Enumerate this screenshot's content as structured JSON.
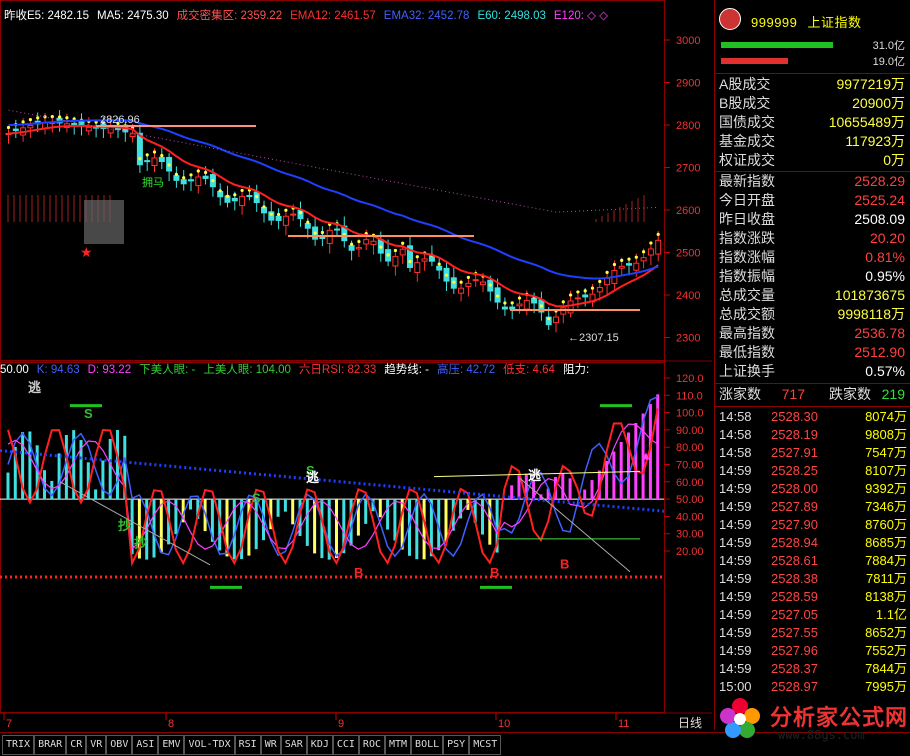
{
  "main_indicators": [
    {
      "label": "昨收E5: 2482.15",
      "color": "#ffffff"
    },
    {
      "label": "MA5: 2475.30",
      "color": "#ffffff"
    },
    {
      "label": "成交密集区: 2359.22",
      "color": "#ff5050"
    },
    {
      "label": "EMA12: 2461.57",
      "color": "#ff3030"
    },
    {
      "label": "EMA32: 2452.78",
      "color": "#4060ff"
    },
    {
      "label": "E60: 2498.03",
      "color": "#30e0e0"
    },
    {
      "label": "E120: ◇ ◇",
      "color": "#ff40ff"
    }
  ],
  "main_price_axis": [
    "3000",
    "2900",
    "2800",
    "2700",
    "2600",
    "2500",
    "2400",
    "2300"
  ],
  "main_annotations": {
    "high_label": "2826.96",
    "low_label": "←2307.15",
    "text_tag": "拥马"
  },
  "sub_indicators": [
    {
      "label": "50.00",
      "color": "#ffffff"
    },
    {
      "label": "K: 94.63",
      "color": "#4060ff"
    },
    {
      "label": "D: 93.22",
      "color": "#ff40ff"
    },
    {
      "label": "下美人眼: -",
      "color": "#30d030"
    },
    {
      "label": "上美人眼: 104.00",
      "color": "#30d030"
    },
    {
      "label": "六日RSI: 82.33",
      "color": "#ff3030"
    },
    {
      "label": "趋势线: -",
      "color": "#ffffff"
    },
    {
      "label": "高压: 42.72",
      "color": "#4060ff"
    },
    {
      "label": "低支: 4.64",
      "color": "#ff3030"
    },
    {
      "label": "阻力:",
      "color": "#ffffff"
    }
  ],
  "sub_axis": [
    "120.0",
    "110.0",
    "100.0",
    "90.00",
    "80.00",
    "70.00",
    "60.00",
    "50.00",
    "40.00",
    "30.00",
    "20.00"
  ],
  "sub_markers": [
    "S",
    "S",
    "S",
    "B",
    "B",
    "B",
    "抄",
    "抄",
    "逃",
    "逃",
    "逃"
  ],
  "date_axis": [
    "7",
    "8",
    "9",
    "10",
    "11"
  ],
  "period_label": "日线",
  "panel": {
    "code": "999999",
    "name": "上证指数",
    "flow": [
      {
        "value": "31.0亿",
        "color": "#20c020",
        "fraction": 0.8
      },
      {
        "value": "19.0亿",
        "color": "#e03030",
        "fraction": 0.48
      }
    ],
    "volumes": [
      {
        "k": "A股成交",
        "v": "9977219万"
      },
      {
        "k": "B股成交",
        "v": "20900万"
      },
      {
        "k": "国债成交",
        "v": "10655489万"
      },
      {
        "k": "基金成交",
        "v": "117923万"
      },
      {
        "k": "权证成交",
        "v": "0万"
      }
    ],
    "stats": [
      {
        "k": "最新指数",
        "v": "2528.29",
        "c": "#ff4040"
      },
      {
        "k": "今日开盘",
        "v": "2525.24",
        "c": "#ff4040"
      },
      {
        "k": "昨日收盘",
        "v": "2508.09",
        "c": "#ffffff"
      },
      {
        "k": "指数涨跌",
        "v": "20.20",
        "c": "#ff4040"
      },
      {
        "k": "指数涨幅",
        "v": "0.81%",
        "c": "#ff4040"
      },
      {
        "k": "指数振幅",
        "v": "0.95%",
        "c": "#ffffff"
      },
      {
        "k": "总成交量",
        "v": "101873675",
        "c": "#ffff40"
      },
      {
        "k": "总成交额",
        "v": "9998118万",
        "c": "#ffff40"
      },
      {
        "k": "最高指数",
        "v": "2536.78",
        "c": "#ff4040"
      },
      {
        "k": "最低指数",
        "v": "2512.90",
        "c": "#ff4040"
      },
      {
        "k": "上证换手",
        "v": "0.57%",
        "c": "#ffffff"
      }
    ],
    "breadth": {
      "up_label": "涨家数",
      "up": "717",
      "down_label": "跌家数",
      "down": "219"
    },
    "ticks": [
      {
        "t": "14:58",
        "p": "2528.30",
        "q": "8074万"
      },
      {
        "t": "14:58",
        "p": "2528.19",
        "q": "9808万"
      },
      {
        "t": "14:58",
        "p": "2527.91",
        "q": "7547万"
      },
      {
        "t": "14:59",
        "p": "2528.25",
        "q": "8107万"
      },
      {
        "t": "14:59",
        "p": "2528.00",
        "q": "9392万"
      },
      {
        "t": "14:59",
        "p": "2527.89",
        "q": "7346万"
      },
      {
        "t": "14:59",
        "p": "2527.90",
        "q": "8760万"
      },
      {
        "t": "14:59",
        "p": "2528.94",
        "q": "8685万"
      },
      {
        "t": "14:59",
        "p": "2528.61",
        "q": "7884万"
      },
      {
        "t": "14:59",
        "p": "2528.38",
        "q": "7811万"
      },
      {
        "t": "14:59",
        "p": "2528.59",
        "q": "8138万"
      },
      {
        "t": "14:59",
        "p": "2527.05",
        "q": "1.1亿"
      },
      {
        "t": "14:59",
        "p": "2527.55",
        "q": "8652万"
      },
      {
        "t": "14:59",
        "p": "2527.96",
        "q": "7552万"
      },
      {
        "t": "14:59",
        "p": "2528.37",
        "q": "7844万"
      },
      {
        "t": "15:00",
        "p": "2528.97",
        "q": "7995万"
      }
    ]
  },
  "tabs": [
    "TRIX",
    "BRAR",
    "CR",
    "VR",
    "OBV",
    "ASI",
    "EMV",
    "VOL-TDX",
    "RSI",
    "WR",
    "SAR",
    "KDJ",
    "CCI",
    "ROC",
    "MTM",
    "BOLL",
    "PSY",
    "MCST"
  ],
  "watermark": {
    "title": "分析家公式网",
    "url": "www.88gs.com"
  }
}
